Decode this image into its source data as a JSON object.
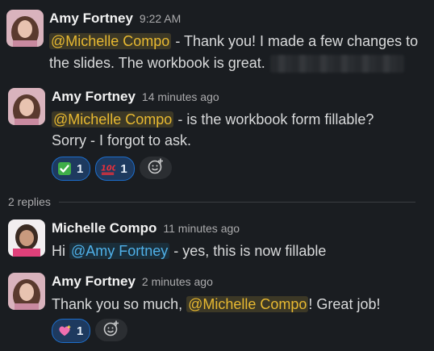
{
  "messages": [
    {
      "author": "Amy Fortney",
      "time": "9:22 AM",
      "line1_mention": "@Michelle Compo",
      "line1_text": " - Thank you! I made a few changes to",
      "line2_text": "the slides. The workbook is great."
    },
    {
      "author": "Amy Fortney",
      "time": "14 minutes ago",
      "line1_mention": "@Michelle Compo",
      "line1_text": " - is the workbook form fillable?",
      "line2_text": "Sorry - I forgot to ask.",
      "reactions": [
        {
          "icon": "white-check-mark",
          "count": "1"
        },
        {
          "icon": "hundred-points",
          "count": "1"
        }
      ]
    }
  ],
  "replies_label": "2 replies",
  "replies": [
    {
      "author": "Michelle Compo",
      "time": "11 minutes ago",
      "text_prefix": "Hi ",
      "mention": "@Amy Fortney",
      "text_suffix": " - yes, this is now fillable"
    },
    {
      "author": "Amy Fortney",
      "time": "2 minutes ago",
      "text_prefix": "Thank you so much, ",
      "mention": "@Michelle Compo",
      "text_suffix": "! Great job!",
      "reactions": [
        {
          "icon": "sparkling-heart",
          "count": "1"
        }
      ]
    }
  ],
  "colors": {
    "background": "#1a1d21",
    "mention": "#e8b931",
    "mention_self": "#4fb0e8",
    "reaction_border": "#1d6ecc"
  }
}
